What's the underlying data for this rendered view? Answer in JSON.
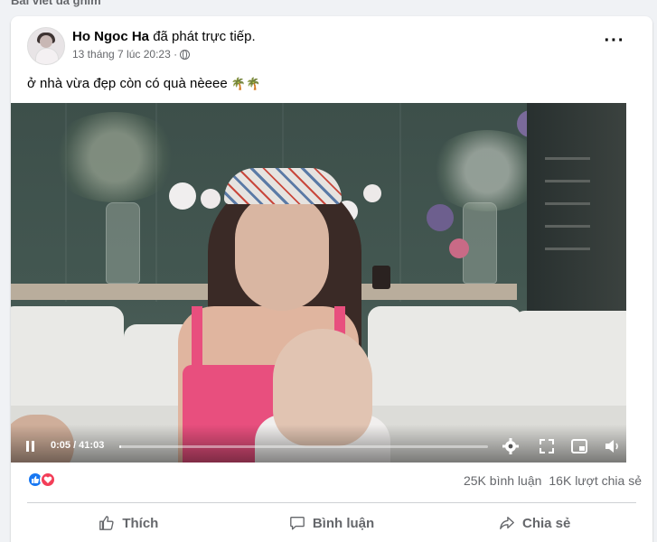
{
  "top_label": "Bài viết đã ghim",
  "post": {
    "author": "Ho Ngoc Ha",
    "action": "đã phát trực tiếp.",
    "timestamp": "13 tháng 7 lúc 20:23 ·",
    "caption": "ở nhà vừa đẹp còn có quà nèeee",
    "caption_emoji": "🌴🌴"
  },
  "video": {
    "time": "0:05 / 41:03",
    "progress": 0.002,
    "icons": [
      "pause-icon",
      "settings-icon",
      "fullscreen-icon",
      "miniplayer-icon",
      "volume-icon"
    ]
  },
  "stats": {
    "comments": "25K bình luận",
    "shares": "16K lượt chia sẻ",
    "reaction_icons": [
      "like-reaction-icon",
      "love-reaction-icon"
    ]
  },
  "actions": {
    "like": "Thích",
    "comment": "Bình luận",
    "share": "Chia sẻ"
  },
  "colors": {
    "accent": "#1877f2",
    "love": "#f33e58",
    "dress": "#e84f7e"
  }
}
